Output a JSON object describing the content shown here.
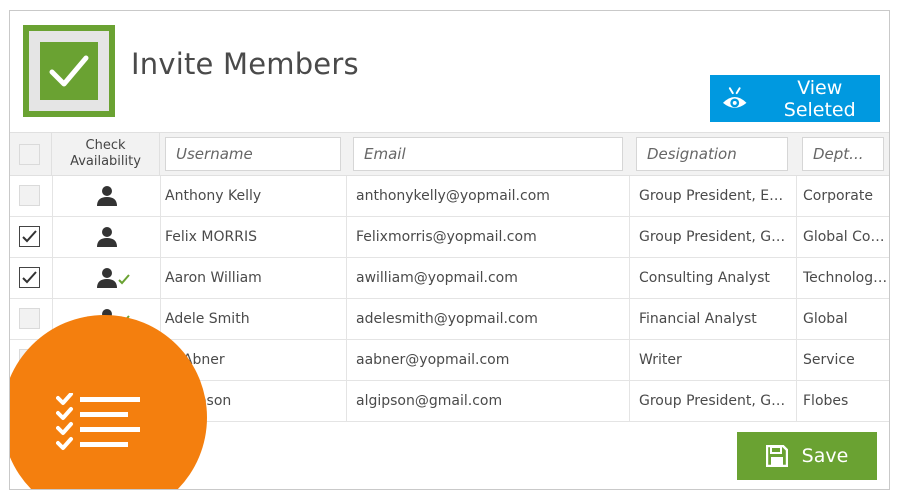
{
  "header": {
    "title": "Invite Members",
    "view_selected_label": "View Seleted"
  },
  "table": {
    "columns": {
      "check_availability": [
        "Check",
        "Availability"
      ],
      "username_placeholder": "Username",
      "email_placeholder": "Email",
      "designation_placeholder": "Designation",
      "department_placeholder": "Dept..."
    },
    "rows": [
      {
        "checked": false,
        "available": false,
        "username": "Anthony Kelly",
        "email": "anthonykelly@yopmail.com",
        "designation": "Group President, Ent...",
        "department": "Corporate"
      },
      {
        "checked": true,
        "available": false,
        "username": "Felix MORRIS",
        "email": "Felixmorris@yopmail.com",
        "designation": "Group President, Glo...",
        "department": "Global Cons..."
      },
      {
        "checked": true,
        "available": true,
        "username": "Aaron William",
        "email": "awilliam@yopmail.com",
        "designation": "Consulting Analyst",
        "department": "Technologies"
      },
      {
        "checked": false,
        "available": true,
        "username": "Adele Smith",
        "email": "adelesmith@yopmail.com",
        "designation": "Financial Analyst",
        "department": "Global"
      },
      {
        "checked": false,
        "available": false,
        "username": "Al Abner",
        "email": "aabner@yopmail.com",
        "designation": "Writer",
        "department": "Service"
      },
      {
        "checked": false,
        "available": false,
        "username": "Al Gipson",
        "email": "algipson@gmail.com",
        "designation": "Group President, Glo...",
        "department": "Flobes"
      }
    ]
  },
  "footer": {
    "save_label": "Save"
  },
  "colors": {
    "accent_green": "#6aa232",
    "accent_blue": "#0099e0",
    "badge_orange": "#f47f0e"
  },
  "icons": {
    "logo": "checkmark-icon",
    "view_selected": "eye-icon",
    "availability": "user-icon",
    "available_check": "check-icon",
    "save": "floppy-disk-icon",
    "badge": "checklist-icon"
  }
}
